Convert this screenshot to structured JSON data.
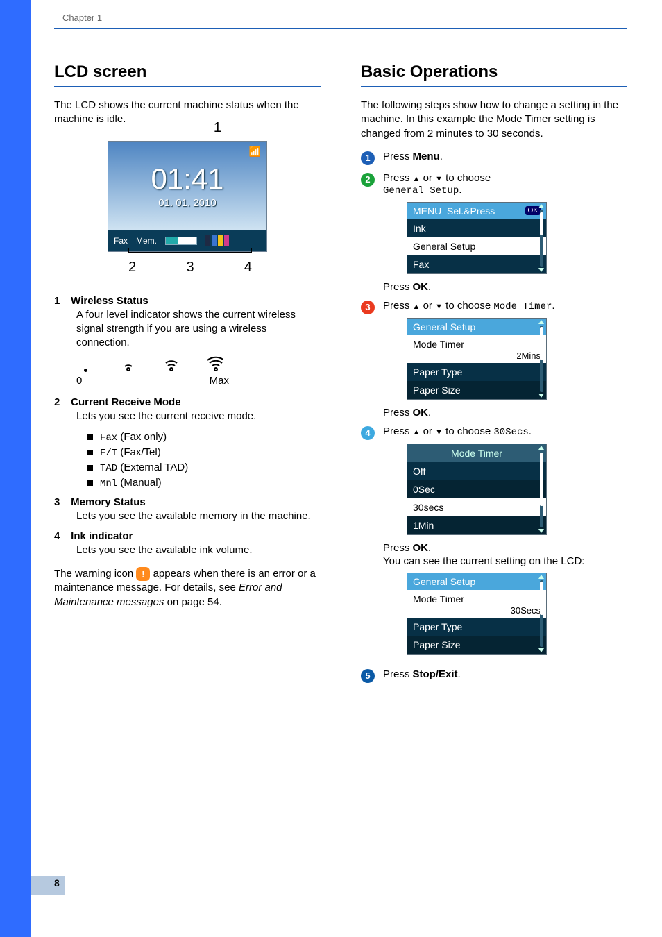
{
  "chapter": "Chapter 1",
  "page_number": "8",
  "left": {
    "heading": "LCD screen",
    "intro": "The LCD shows the current machine status when the machine is idle.",
    "lcd": {
      "time": "01:41",
      "date": "01. 01. 2010",
      "fax_label": "Fax",
      "mem_label": "Mem.",
      "ink_colors": [
        "#1e2a44",
        "#3a74d0",
        "#f2c21a",
        "#d23a8a"
      ],
      "callouts": {
        "c1": "1",
        "c2": "2",
        "c3": "3",
        "c4": "4"
      }
    },
    "legend": [
      {
        "n": "1",
        "name": "Wireless Status",
        "desc": "A four level indicator shows the current wireless signal strength if you are using a wireless connection."
      },
      {
        "n": "2",
        "name": "Current Receive Mode",
        "desc": "Lets you see the current receive mode."
      },
      {
        "n": "3",
        "name": "Memory Status",
        "desc": "Lets you see the available memory in the machine."
      },
      {
        "n": "4",
        "name": "Ink indicator",
        "desc": "Lets you see the available ink volume."
      }
    ],
    "wifi_scale": {
      "low": "0",
      "high": "Max"
    },
    "modes": [
      {
        "code": "Fax",
        "label": " (Fax only)"
      },
      {
        "code": "F/T",
        "label": " (Fax/Tel)"
      },
      {
        "code": "TAD",
        "label": " (External TAD)"
      },
      {
        "code": "Mnl",
        "label": " (Manual)"
      }
    ],
    "warning_a": "The warning icon ",
    "warning_b": " appears when there is an error or a maintenance message. For details, see ",
    "warning_ref": "Error and Maintenance messages",
    "warning_c": " on page 54."
  },
  "right": {
    "heading": "Basic Operations",
    "intro": "The following steps show how to change a setting in the machine. In this example the Mode Timer setting is changed from 2 minutes to 30 seconds.",
    "steps": {
      "s1": {
        "press": "Press ",
        "menu": "Menu",
        "dot": "."
      },
      "s2": {
        "line1a": "Press ",
        "line1b": " or ",
        "line1c": " to choose",
        "code": "General Setup",
        "dot": ".",
        "after": "Press ",
        "ok": "OK",
        "dot2": "."
      },
      "s3": {
        "line_a": "Press ",
        "line_b": " or ",
        "line_c": " to choose ",
        "code": "Mode Timer",
        "dot": ".",
        "after": "Press ",
        "ok": "OK",
        "dot2": "."
      },
      "s4": {
        "line_a": "Press ",
        "line_b": " or ",
        "line_c": " to choose ",
        "code": "30Secs",
        "dot": ".",
        "after": "Press ",
        "ok": "OK",
        "dot2": ".",
        "result": "You can see the current setting on the LCD:"
      },
      "s5": {
        "press": "Press ",
        "stop": "Stop/Exit",
        "dot": "."
      }
    },
    "screen1": {
      "title_a": "MENU",
      "title_b": "Sel.&Press",
      "ok": "OK",
      "rows": [
        "Ink",
        "General Setup",
        "Fax"
      ]
    },
    "screen2": {
      "title": "General Setup",
      "row1": "Mode Timer",
      "val1": "2Mins",
      "row2": "Paper Type",
      "row3": "Paper Size"
    },
    "screen3": {
      "title": "Mode Timer",
      "rows": [
        "Off",
        "0Sec",
        "30secs",
        "1Min"
      ]
    },
    "screen4": {
      "title": "General Setup",
      "row1": "Mode Timer",
      "val1": "30Secs",
      "row2": "Paper Type",
      "row3": "Paper Size"
    }
  }
}
